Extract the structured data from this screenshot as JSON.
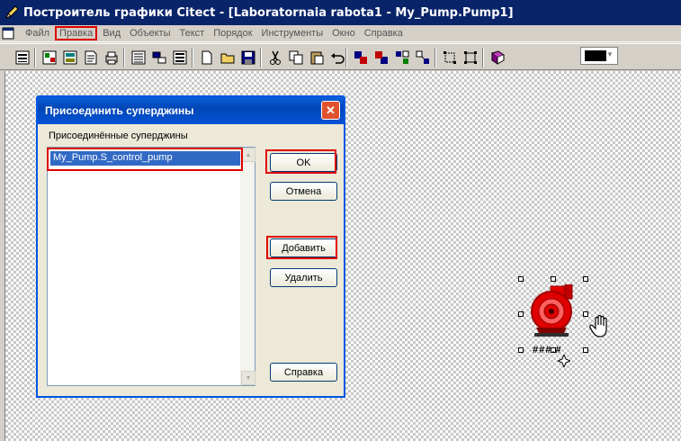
{
  "window": {
    "title": "Построитель графики Citect - [Laboratornaia rabota1 - My_Pump.Pump1]"
  },
  "menu": {
    "items": [
      "Файл",
      "Правка",
      "Вид",
      "Объекты",
      "Текст",
      "Порядок",
      "Инструменты",
      "Окно",
      "Справка"
    ],
    "highlighted": "Правка"
  },
  "toolbar": {
    "color_value": "#000000"
  },
  "dialog": {
    "title": "Присоединить суперджины",
    "list_label": "Присоединённые суперджины",
    "list_items": [
      "My_Pump.S_control_pump"
    ],
    "buttons": {
      "ok": "OK",
      "cancel": "Отмена",
      "add": "Добавить",
      "delete": "Удалить",
      "help": "Справка"
    },
    "close_glyph": "✕"
  },
  "canvas": {
    "pump_label": "###.#"
  },
  "colors": {
    "title_bar": "#0a246a",
    "dialog_title": "#0246b6",
    "highlight_red": "#e00000",
    "pump_red": "#e00000"
  }
}
